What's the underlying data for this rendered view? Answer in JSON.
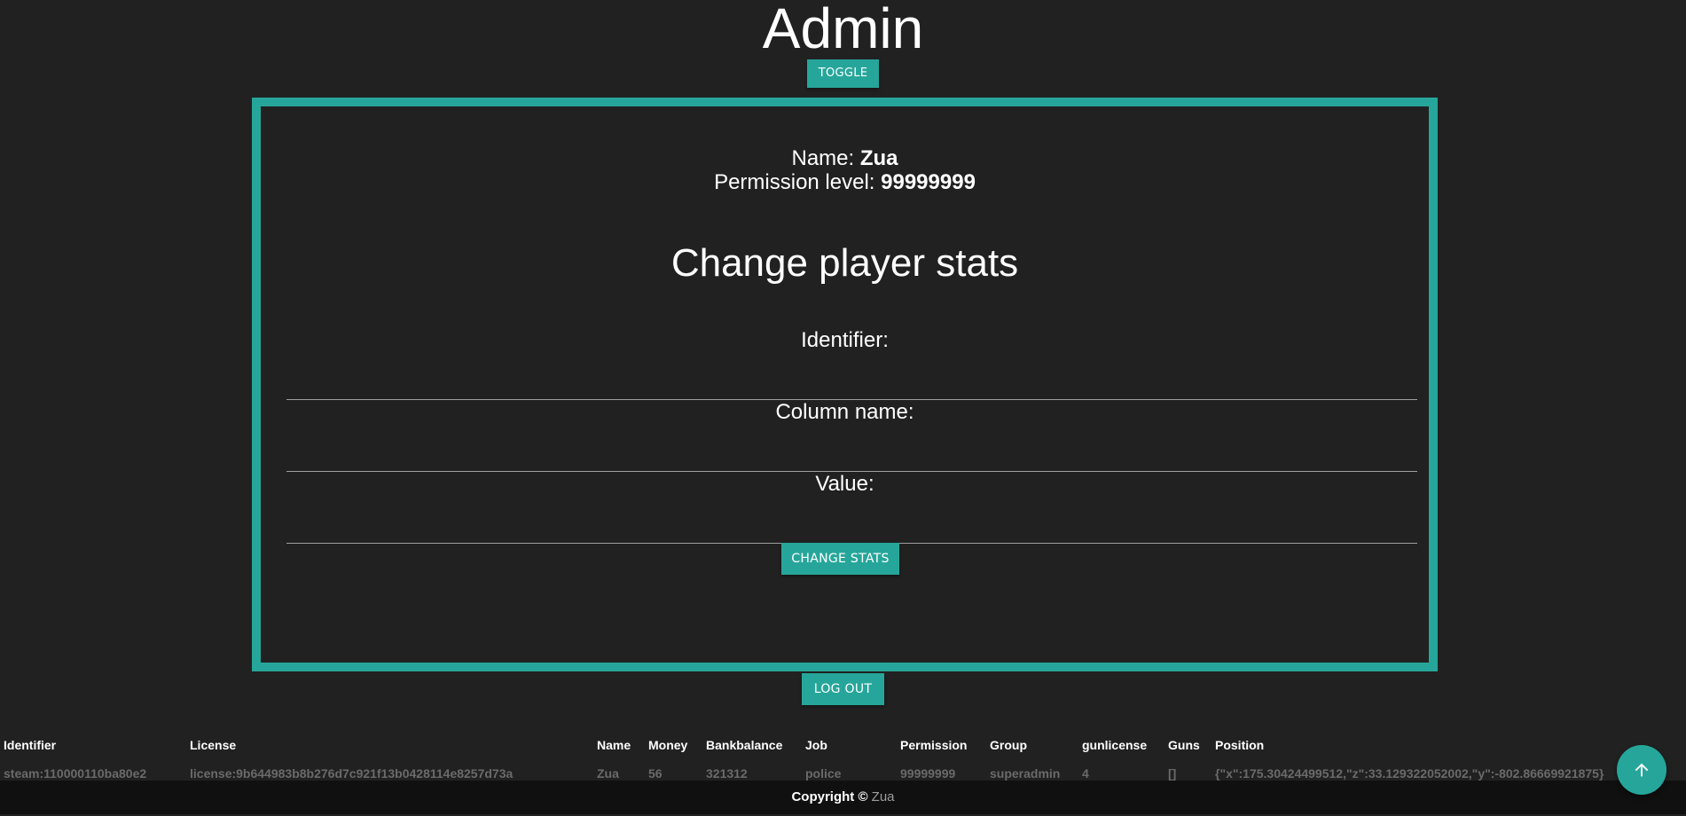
{
  "header": {
    "title": "Admin",
    "toggle_label": "TOGGLE"
  },
  "profile": {
    "name_label": "Name:",
    "name_value": "Zua",
    "permission_label": "Permission level:",
    "permission_value": "99999999"
  },
  "stats_form": {
    "title": "Change player stats",
    "identifier_label": "Identifier:",
    "identifier_value": "",
    "column_label": "Column name:",
    "column_value": "",
    "value_label": "Value:",
    "value_value": "",
    "submit_label": "CHANGE STATS"
  },
  "logout_label": "LOG OUT",
  "table": {
    "columns": [
      "Identifier",
      "License",
      "Name",
      "Money",
      "Bankbalance",
      "Job",
      "Permission",
      "Group",
      "gunlicense",
      "Guns",
      "Position"
    ],
    "rows": [
      [
        "steam:110000110ba80e2",
        "license:9b644983b8b276d7c921f13b0428114e8257d73a",
        "Zua",
        "56",
        "321312",
        "police",
        "99999999",
        "superadmin",
        "4",
        "[]",
        "{\"x\":175.30424499512,\"z\":33.129322052002,\"y\":-802.86669921875}"
      ]
    ]
  },
  "footer": {
    "copyright_label": "Copyright ©",
    "copyright_name": "Zua"
  },
  "scroll_top_icon": "arrow-up-icon",
  "colors": {
    "accent": "#26a69a",
    "background": "#212121"
  }
}
